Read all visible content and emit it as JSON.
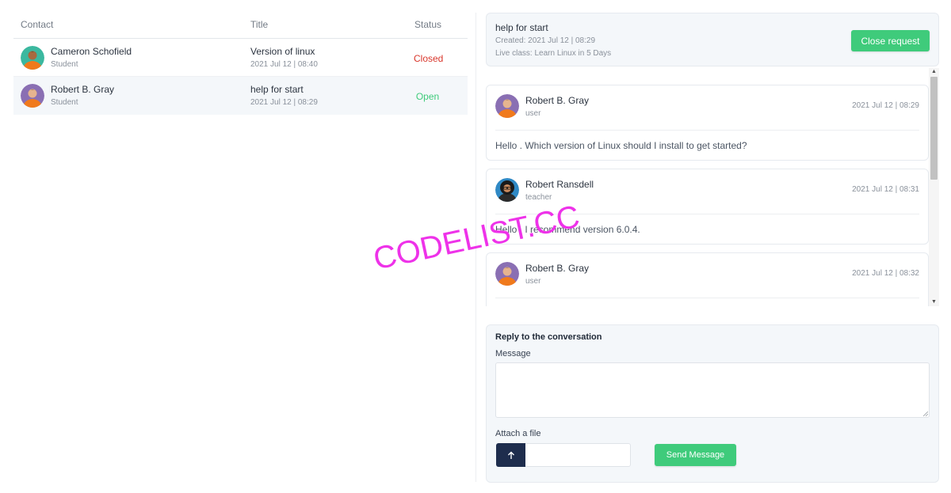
{
  "table": {
    "headers": {
      "contact": "Contact",
      "title": "Title",
      "status": "Status"
    },
    "rows": [
      {
        "name": "Cameron Schofield",
        "role": "Student",
        "title": "Version of linux",
        "date": "2021 Jul 12 | 08:40",
        "status": "Closed",
        "status_color": "#d9362b",
        "avatar": "avatar-green"
      },
      {
        "name": "Robert B. Gray",
        "role": "Student",
        "title": "help for start",
        "date": "2021 Jul 12 | 08:29",
        "status": "Open",
        "status_color": "#3fcb7b",
        "avatar": "avatar-purple"
      }
    ]
  },
  "request": {
    "title": "help for start",
    "created": "Created: 2021 Jul 12 | 08:29",
    "live_class": "Live class: Learn Linux in 5 Days",
    "close_label": "Close request"
  },
  "messages": [
    {
      "name": "Robert B. Gray",
      "role": "user",
      "date": "2021 Jul 12 | 08:29",
      "text": "Hello . Which version of Linux should I install to get started?"
    },
    {
      "name": "Robert Ransdell",
      "role": "teacher",
      "date": "2021 Jul 12 | 08:31",
      "text": "Hello . I recommend version 6.0.4."
    },
    {
      "name": "Robert B. Gray",
      "role": "user",
      "date": "2021 Jul 12 | 08:32",
      "text": ""
    }
  ],
  "reply": {
    "heading": "Reply to the conversation",
    "message_label": "Message",
    "message_value": "",
    "attach_label": "Attach a file",
    "send_label": "Send Message",
    "upload_icon": "arrow-up-icon"
  },
  "watermark": "CODELIST.CC",
  "colors": {
    "accent_green": "#3fcb7b",
    "closed_red": "#d9362b",
    "navy": "#1e2d4d",
    "panel_bg": "#f4f7fa",
    "watermark": "#ee32e9"
  }
}
